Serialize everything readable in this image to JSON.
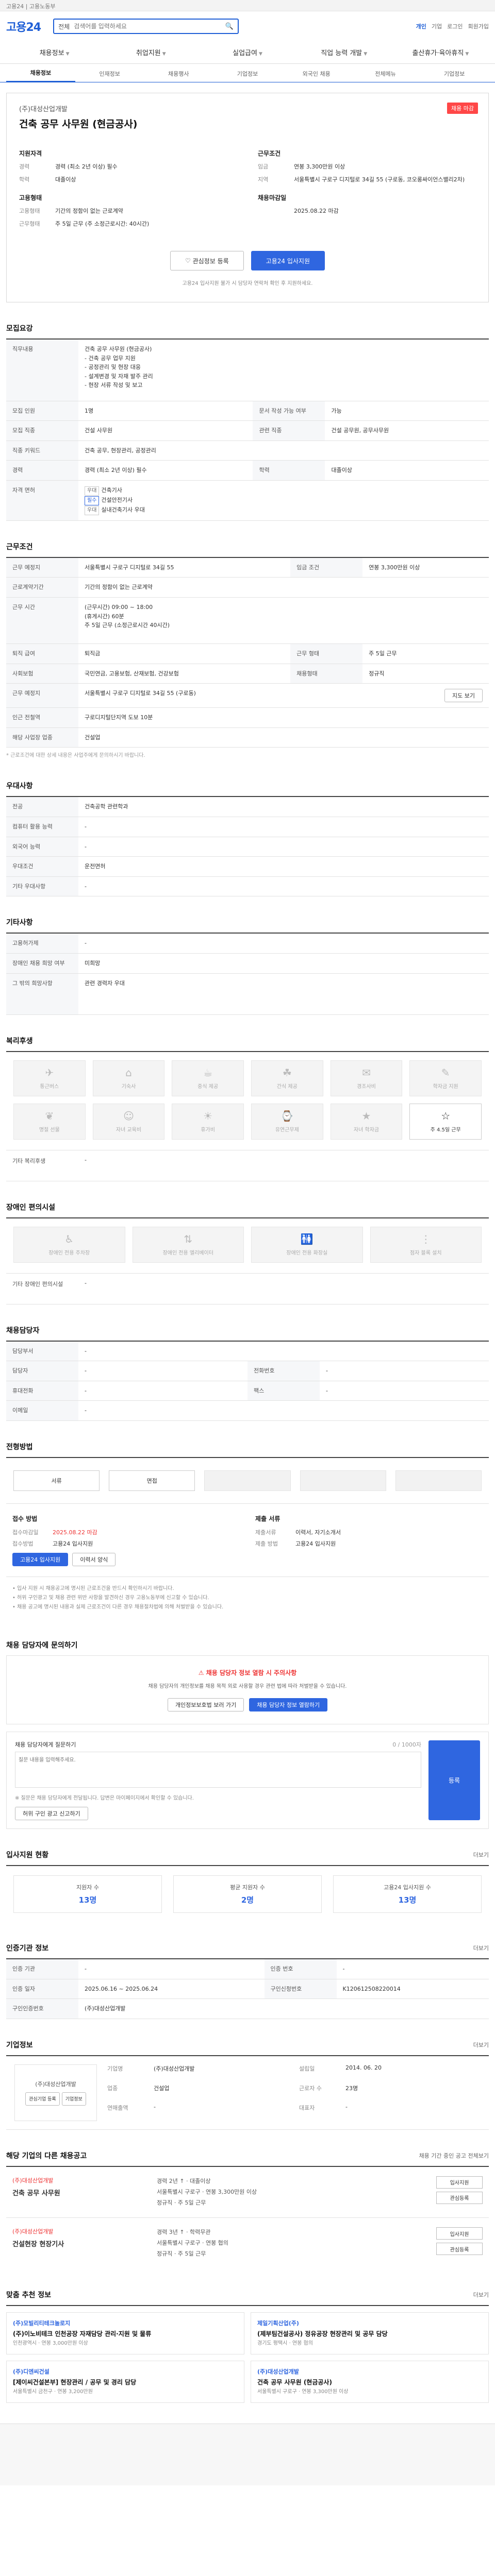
{
  "util": {
    "text": "고용24 | 고용노동부"
  },
  "header": {
    "logo": "고용24",
    "search_scope": "전체",
    "search_placeholder": "검색어를 입력하세요",
    "links": [
      "개인",
      "기업",
      "로그인",
      "회원가입"
    ]
  },
  "gnb": [
    "채용정보",
    "취업지원",
    "실업급여",
    "직업 능력 개발",
    "출산휴가·육아휴직"
  ],
  "sub_tabs": [
    "채용정보",
    "인재정보",
    "채용행사",
    "기업정보",
    "외국인 채용",
    "전체메뉴",
    "기업정보"
  ],
  "summary": {
    "company": "(주)대성산업개발",
    "title": "건축 공무 사무원 (현금공사)",
    "badge": "채용 마감",
    "left_h": "지원자격",
    "left_rows": [
      {
        "k": "경력",
        "v": "경력 (최소 2년 이상) 필수"
      },
      {
        "k": "학력",
        "v": "대졸이상"
      }
    ],
    "left_h2": "고용형태",
    "left_rows2": [
      {
        "k": "고용형태",
        "v": "기간의 정함이 없는 근로계약"
      },
      {
        "k": "근무형태",
        "v": "주 5일 근무 (주 소정근로시간: 40시간)"
      }
    ],
    "right_h": "근무조건",
    "right_rows": [
      {
        "k": "임금",
        "v": "연봉 3,300만원 이상"
      },
      {
        "k": "지역",
        "v": "서울특별시 구로구 디지털로 34길 55 (구로동, 코오롱싸이언스밸리2차)"
      }
    ],
    "right_h2": "채용마감일",
    "right_rows2": [
      {
        "k": "",
        "v": "2025.08.22 마감"
      }
    ],
    "btn_interest": "관심정보 등록",
    "btn_apply": "고용24 입사지원",
    "notice": "고용24 입사지원 불가 시 담당자 연락처 확인 후 지원하세요."
  },
  "recruit": {
    "title": "모집요강",
    "job_h": "직무내용",
    "job": "건축 공무 사무원 (현금공사)\n- 건축 공무 업무 지원\n- 공정관리 및 현장 대응\n- 설계변경 및 자재 발주 관리\n- 현장 서류 작성 및 보고",
    "rows": [
      {
        "k": "모집 인원",
        "v": "1명",
        "k2": "문서 작성 가능 여부",
        "v2": "가능"
      },
      {
        "k": "모집 직종",
        "v": "건설 사무원",
        "k2": "관련 직종",
        "v2": "건설 공무원, 공무사무원"
      },
      {
        "k": "직종 키워드",
        "v": "건축 공무, 현장관리, 공정관리",
        "k2": "",
        "v2": ""
      },
      {
        "k": "경력",
        "v": "경력 (최소 2년 이상) 필수",
        "k2": "학력",
        "v2": "대졸이상"
      }
    ],
    "cert_k": "자격 면허",
    "certs": [
      "건축기사",
      "건설안전기사",
      "실내건축기사 우대"
    ],
    "cert_tags": [
      "우대",
      "필수",
      "우대"
    ]
  },
  "condition": {
    "title": "근무조건",
    "rows": [
      {
        "k": "근무 예정지",
        "v": "서울특별시 구로구 디지털로 34길 55",
        "k2": "임금 조건",
        "v2": "연봉 3,300만원 이상"
      },
      {
        "k": "근로계약기간",
        "v": "기간의 정함이 없는 근로계약",
        "k2": "",
        "v2": ""
      },
      {
        "k": "근무 시간",
        "v": "(근무시간) 09:00 ~ 18:00\n(휴게시간) 60분\n주 5일 근무 (소정근로시간 40시간)",
        "k2": "",
        "v2": ""
      },
      {
        "k": "퇴직 급여",
        "v": "퇴직금",
        "k2": "근무 형태",
        "v2": "주 5일 근무"
      },
      {
        "k": "사회보험",
        "v": "국민연금, 고용보험, 산재보험, 건강보험",
        "k2": "채용형태",
        "v2": "정규직"
      },
      {
        "k": "근무 예정지",
        "v": "서울특별시 구로구 디지털로 34길 55 (구로동)",
        "k2": "",
        "v2": ""
      },
      {
        "k": "인근 전철역",
        "v": "구로디지털단지역 도보 10분",
        "k2": "",
        "v2": ""
      },
      {
        "k": "해당 사업장 업종",
        "v": "건설업",
        "k2": "",
        "v2": ""
      }
    ],
    "map_button": "지도 보기",
    "note": "* 근로조건에 대한 상세 내용은 사업주에게 문의하시기 바랍니다."
  },
  "preference": {
    "title": "우대사항",
    "rows": [
      {
        "k": "전공",
        "v": "건축공학 관련학과"
      },
      {
        "k": "컴퓨터 활용 능력",
        "v": "-"
      },
      {
        "k": "외국어 능력",
        "v": "-"
      },
      {
        "k": "우대조건",
        "v": "운전면허"
      },
      {
        "k": "기타 우대사항",
        "v": "-"
      }
    ]
  },
  "other": {
    "title": "기타사항",
    "rows": [
      {
        "k": "고용허가제",
        "v": "-"
      },
      {
        "k": "장애인 채용 희망 여부",
        "v": "미희망"
      },
      {
        "k": "그 밖의 희망사항",
        "v": "관련 경력자 우대"
      }
    ]
  },
  "welfare": {
    "title": "복리후생",
    "items": [
      "통근버스",
      "기숙사",
      "중식 제공",
      "간식 제공",
      "경조사비",
      "학자금 지원",
      "명절 선물",
      "자녀 교육비",
      "휴가비",
      "유연근무제",
      "자녀 학자금",
      "주 4.5일 근무"
    ],
    "on": [
      false,
      false,
      false,
      false,
      false,
      false,
      false,
      false,
      false,
      false,
      false,
      true
    ],
    "detail_k": "기타 복리후생",
    "detail_v": "-"
  },
  "disabled": {
    "title": "장애인 편의시설",
    "items": [
      "장애인 전용 주차장",
      "장애인 전용 엘리베이터",
      "장애인 전용 화장실",
      "점자 블록 설치"
    ],
    "detail_k": "기타 장애인 편의시설",
    "detail_v": "-"
  },
  "manager": {
    "title": "채용담당자",
    "rows": [
      {
        "k": "담당부서",
        "v": "-",
        "k2": "",
        "v2": ""
      },
      {
        "k": "담당자",
        "v": "-",
        "k2": "전화번호",
        "v2": "-"
      },
      {
        "k": "휴대전화",
        "v": "-",
        "k2": "팩스",
        "v2": "-"
      },
      {
        "k": "이메일",
        "v": "-",
        "k2": "",
        "v2": ""
      }
    ]
  },
  "process": {
    "title": "전형방법",
    "steps": [
      "서류",
      "면접",
      "",
      "",
      ""
    ],
    "apply_h": "접수 방법",
    "apply_rows": [
      {
        "k": "접수마감일",
        "v": "2025.08.22 마감"
      },
      {
        "k": "접수방법",
        "v": "고용24 입사지원"
      }
    ],
    "submit_h": "제출 서류",
    "submit_rows": [
      {
        "k": "제출서류",
        "v": "이력서, 자기소개서"
      },
      {
        "k": "제출 방법",
        "v": "고용24 입사지원"
      }
    ],
    "btn_apply": "고용24 입사지원",
    "btn_form": "이력서 양식",
    "bullets": [
      "• 입사 지원 시 채용공고에 명시된 근로조건을 반드시 확인하시기 바랍니다.",
      "• 허위 구인광고 및 채용 관련 위반 사항을 발견하신 경우 고용노동부에 신고할 수 있습니다.",
      "• 채용 공고에 명시된 내용과 실제 근로조건이 다른 경우 채용절차법에 의해 처벌받을 수 있습니다."
    ]
  },
  "inquiry": {
    "title": "채용 담당자에 문의하기",
    "warn_title": "채용 담당자 정보 열람 시 주의사항",
    "warn_text": "채용 담당자의 개인정보를 채용 목적 외로 사용할 경우 관련 법에 따라 처벌받을 수 있습니다.",
    "btn1": "개인정보보호법 보러 가기",
    "btn2": "채용 담당자 정보 열람하기",
    "form_label": "채용 담당자에게 질문하기",
    "counter": "0 / 1000자",
    "placeholder": "질문 내용을 입력해주세요.",
    "submit": "등록",
    "notes": "※ 질문은 채용 담당자에게 전달됩니다. 답변은 마이페이지에서 확인할 수 있습니다.",
    "report": "허위 구인 광고 신고하기"
  },
  "stats": {
    "title": "입사지원 현황",
    "more": "더보기",
    "items": [
      {
        "k": "지원자 수",
        "v": "13명"
      },
      {
        "k": "평균 지원자 수",
        "v": "2명"
      },
      {
        "k": "고용24 입사지원 수",
        "v": "13명"
      }
    ]
  },
  "info": {
    "title": "인증기관 정보",
    "more": "더보기",
    "rows": [
      {
        "k": "인증 기관",
        "v": "-",
        "k2": "인증 번호",
        "v2": "-"
      },
      {
        "k": "인증 일자",
        "v": "2025.06.16 ~ 2025.06.24",
        "k2": "구인신청번호",
        "v2": "K120612508220014"
      },
      {
        "k": "구인인증번호",
        "v": "(주)대성산업개발",
        "k2": "",
        "v2": ""
      }
    ]
  },
  "company_info": {
    "title": "기업정보",
    "more": "더보기",
    "logo_text": "(주)대성산업개발",
    "btn_interest": "관심기업 등록",
    "btn_view": "기업정보",
    "rows": [
      {
        "k": "기업명",
        "v": "(주)대성산업개발"
      },
      {
        "k": "설립일",
        "v": "2014. 06. 20"
      },
      {
        "k": "업종",
        "v": "건설업"
      },
      {
        "k": "근로자 수",
        "v": "23명"
      },
      {
        "k": "연매출액",
        "v": "-"
      },
      {
        "k": "대표자",
        "v": "-"
      }
    ]
  },
  "others": {
    "title": "해당 기업의 다른 채용공고",
    "more": "채용 기간 중인 공고 전체보기",
    "items": [
      {
        "co": "(주)대성산업개발",
        "tt": "건축 공무 사무원",
        "m1": "경력 2년 ↑ · 대졸이상",
        "m2": "서울특별시 구로구 · 연봉 3,300만원 이상",
        "m3": "정규직 · 주 5일 근무"
      },
      {
        "co": "(주)대성산업개발",
        "tt": "건설현장 현장기사",
        "m1": "경력 3년 ↑ · 학력무관",
        "m2": "서울특별시 구로구 · 연봉 협의",
        "m3": "정규직 · 주 5일 근무"
      }
    ],
    "btn_apply": "입사지원",
    "btn_interest": "관심등록"
  },
  "recommend": {
    "title": "맞춤 추천 정보",
    "more": "더보기",
    "items": [
      {
        "co": "(주)모빌리티테크놀로지",
        "tt": "(주)이노비테크 인천공장 자재담당 관리·지원 및 물류",
        "meta": "인천광역시 · 연봉 3,000만원 이상"
      },
      {
        "co": "제일기획산업(주)",
        "tt": "(제부팀건설공사) 정유공장 현장관리 및 공무 담당",
        "meta": "경기도 평택시 · 연봉 협의"
      },
      {
        "co": "(주)디엔씨건설",
        "tt": "[제이씨건설본부] 현장관리 / 공무 및 경리 담당",
        "meta": "서울특별시 금천구 · 연봉 3,200만원"
      },
      {
        "co": "(주)대성산업개발",
        "tt": "건축 공무 사무원 (현금공사)",
        "meta": "서울특별시 구로구 · 연봉 3,300만원 이상"
      }
    ]
  }
}
